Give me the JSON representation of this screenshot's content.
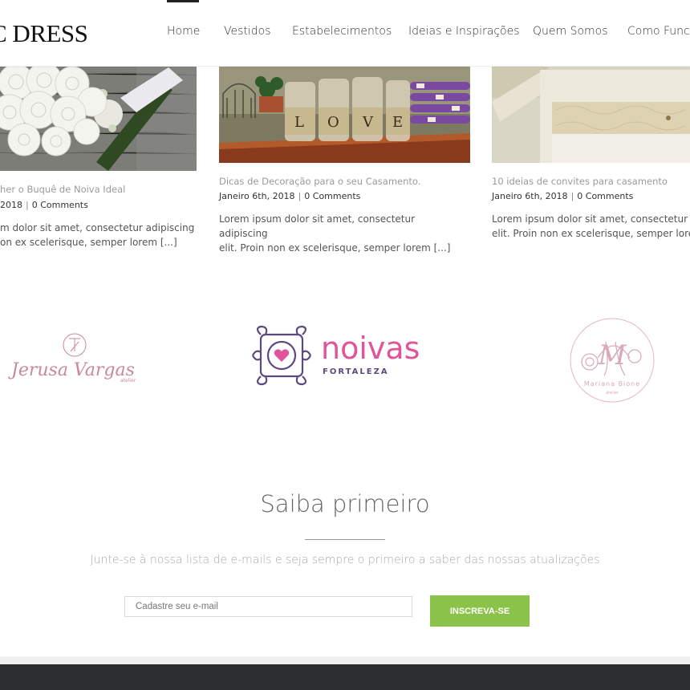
{
  "header": {
    "logo_text": "C DRESS",
    "nav": [
      "Home",
      "Vestidos",
      "Estabelecimentos",
      "Ideias e Inspirações",
      "Quem Somos",
      "Como Funci"
    ]
  },
  "posts": [
    {
      "title": "her o Buquê de Noiva Ideal",
      "date": "2018",
      "comments": "0 Comments",
      "excerpt_line1": "m dolor sit amet, consectetur adipiscing",
      "excerpt_line2": "on ex scelerisque, semper lorem [...]"
    },
    {
      "title": "Dicas de Decoração para o seu Casamento.",
      "date": "Janeiro 6th, 2018",
      "comments": "0 Comments",
      "excerpt_line1": "Lorem ipsum dolor sit amet, consectetur adipiscing",
      "excerpt_line2": "elit. Proin non ex scelerisque, semper lorem [...]"
    },
    {
      "title": "10 ideias de convites para casamento",
      "date": "Janeiro 6th, 2018",
      "comments": "0 Comments",
      "excerpt_line1": "Lorem ipsum dolor sit amet, consectetur a",
      "excerpt_line2": "elit. Proin non ex scelerisque, semper lorem"
    }
  ],
  "partners": {
    "jerusa": {
      "name": "Jerusa Vargas",
      "sub": "atelier"
    },
    "noivas": {
      "name": "noivas",
      "sub": "FORTALEZA"
    },
    "mariana": {
      "name": "Mariana Bione",
      "sub": "atelier"
    }
  },
  "newsletter": {
    "title": "Saiba primeiro",
    "subtitle": "Junte-se à nossa lista de e-mails e seja sempre o primeiro a saber das nossas atualizações",
    "placeholder": "Cadastre seu e-mail",
    "button": "INSCREVA-SE"
  },
  "colors": {
    "accent_green": "#8bc34a",
    "noivas_pink": "#e0559a",
    "noivas_purple": "#5b4a7e",
    "footer_dark": "#2d2e30"
  }
}
